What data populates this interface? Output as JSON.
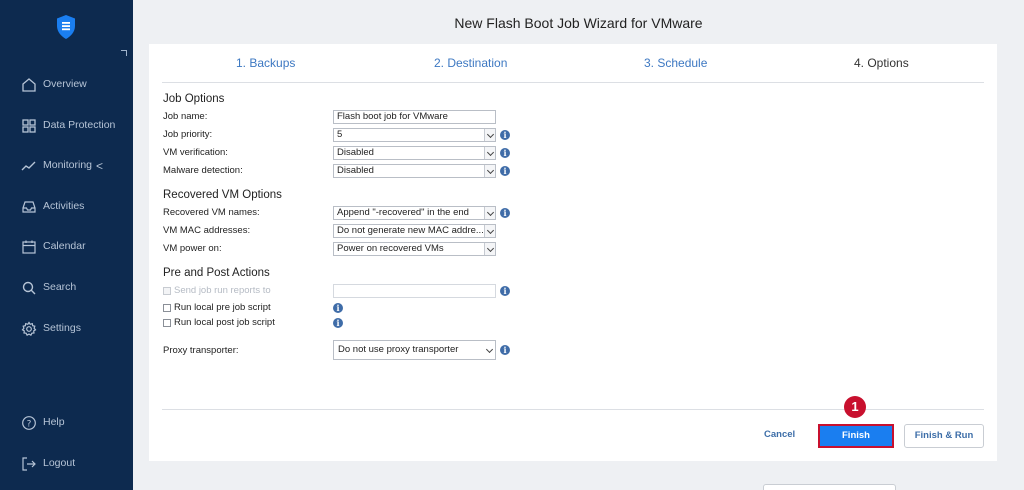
{
  "sidebar": {
    "items": [
      {
        "label": "Overview"
      },
      {
        "label": "Data Protection"
      },
      {
        "label": "Monitoring",
        "chevron": "<"
      },
      {
        "label": "Activities"
      },
      {
        "label": "Calendar"
      },
      {
        "label": "Search"
      },
      {
        "label": "Settings"
      }
    ],
    "bottom": [
      {
        "label": "Help"
      },
      {
        "label": "Logout"
      }
    ]
  },
  "wizard": {
    "title": "New Flash Boot Job Wizard for VMware",
    "steps": [
      "1. Backups",
      "2. Destination",
      "3. Schedule",
      "4. Options"
    ],
    "active_step": "4. Options"
  },
  "job_options": {
    "heading": "Job Options",
    "job_name_label": "Job name:",
    "job_name_value": "Flash boot job for VMware",
    "job_priority_label": "Job priority:",
    "job_priority_value": "5",
    "vm_verification_label": "VM verification:",
    "vm_verification_value": "Disabled",
    "malware_detection_label": "Malware detection:",
    "malware_detection_value": "Disabled"
  },
  "recovered_vm_options": {
    "heading": "Recovered VM Options",
    "names_label": "Recovered VM names:",
    "names_value": "Append \"-recovered\" in the end",
    "mac_label": "VM MAC addresses:",
    "mac_value": "Do not generate new MAC addre...",
    "power_label": "VM power on:",
    "power_value": "Power on recovered VMs"
  },
  "pre_post_actions": {
    "heading": "Pre and Post Actions",
    "send_reports_label": "Send job run reports to",
    "send_reports_value": "",
    "pre_script_label": "Run local pre job script",
    "post_script_label": "Run local post job script"
  },
  "proxy": {
    "label": "Proxy transporter:",
    "value": "Do not use proxy transporter"
  },
  "buttons": {
    "cancel": "Cancel",
    "finish": "Finish",
    "finish_run": "Finish & Run"
  },
  "annotation": {
    "marker": "1"
  },
  "colors": {
    "sidebar_bg": "#0d2a4f",
    "accent": "#1a7ef0",
    "highlight": "#c8102e",
    "link": "#3d78c2"
  }
}
